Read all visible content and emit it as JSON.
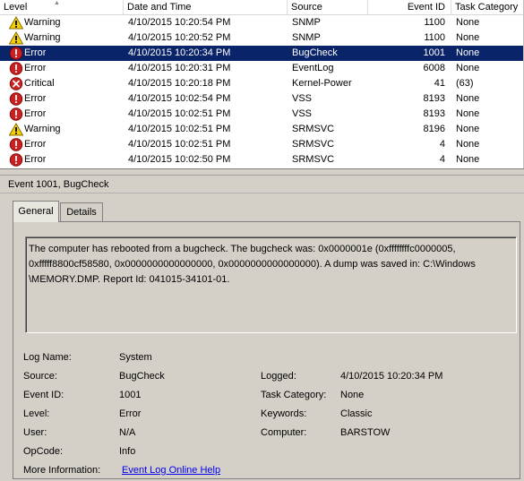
{
  "columns": [
    {
      "key": "level",
      "label": "Level"
    },
    {
      "key": "datetime",
      "label": "Date and Time"
    },
    {
      "key": "source",
      "label": "Source"
    },
    {
      "key": "event_id",
      "label": "Event ID"
    },
    {
      "key": "task_category",
      "label": "Task Category"
    }
  ],
  "rows": [
    {
      "icon": "warning",
      "level": "Warning",
      "datetime": "4/10/2015 10:20:54 PM",
      "source": "SNMP",
      "event_id": "1100",
      "task_category": "None",
      "selected": false
    },
    {
      "icon": "warning",
      "level": "Warning",
      "datetime": "4/10/2015 10:20:52 PM",
      "source": "SNMP",
      "event_id": "1100",
      "task_category": "None",
      "selected": false
    },
    {
      "icon": "error",
      "level": "Error",
      "datetime": "4/10/2015 10:20:34 PM",
      "source": "BugCheck",
      "event_id": "1001",
      "task_category": "None",
      "selected": true
    },
    {
      "icon": "error",
      "level": "Error",
      "datetime": "4/10/2015 10:20:31 PM",
      "source": "EventLog",
      "event_id": "6008",
      "task_category": "None",
      "selected": false
    },
    {
      "icon": "critical",
      "level": "Critical",
      "datetime": "4/10/2015 10:20:18 PM",
      "source": "Kernel-Power",
      "event_id": "41",
      "task_category": "(63)",
      "selected": false
    },
    {
      "icon": "error",
      "level": "Error",
      "datetime": "4/10/2015 10:02:54 PM",
      "source": "VSS",
      "event_id": "8193",
      "task_category": "None",
      "selected": false
    },
    {
      "icon": "error",
      "level": "Error",
      "datetime": "4/10/2015 10:02:51 PM",
      "source": "VSS",
      "event_id": "8193",
      "task_category": "None",
      "selected": false
    },
    {
      "icon": "warning",
      "level": "Warning",
      "datetime": "4/10/2015 10:02:51 PM",
      "source": "SRMSVC",
      "event_id": "8196",
      "task_category": "None",
      "selected": false
    },
    {
      "icon": "error",
      "level": "Error",
      "datetime": "4/10/2015 10:02:51 PM",
      "source": "SRMSVC",
      "event_id": "4",
      "task_category": "None",
      "selected": false
    },
    {
      "icon": "error",
      "level": "Error",
      "datetime": "4/10/2015 10:02:50 PM",
      "source": "SRMSVC",
      "event_id": "4",
      "task_category": "None",
      "selected": false
    }
  ],
  "detail": {
    "title": "Event 1001, BugCheck",
    "tabs": {
      "general": "General",
      "details": "Details"
    },
    "description_lines": [
      "The computer has rebooted from a bugcheck.  The bugcheck was: 0x0000001e (0xffffffffc0000005,",
      "0xfffff8800cf58580, 0x0000000000000000, 0x0000000000000000). A dump was saved in: C:\\Windows",
      "\\MEMORY.DMP. Report Id: 041015-34101-01."
    ],
    "fields": {
      "log_name_label": "Log Name:",
      "log_name": "System",
      "source_label": "Source:",
      "source": "BugCheck",
      "logged_label": "Logged:",
      "logged": "4/10/2015 10:20:34 PM",
      "event_id_label": "Event ID:",
      "event_id": "1001",
      "task_category_label": "Task Category:",
      "task_category": "None",
      "level_label": "Level:",
      "level": "Error",
      "keywords_label": "Keywords:",
      "keywords": "Classic",
      "user_label": "User:",
      "user": "N/A",
      "computer_label": "Computer:",
      "computer": "BARSTOW",
      "opcode_label": "OpCode:",
      "opcode": "Info",
      "more_info_label": "More Information:",
      "more_info_link": "Event Log Online Help"
    }
  },
  "colors": {
    "selection": "#0a246a",
    "link": "#0000ee",
    "warning": "#f5d000",
    "error": "#cc1f1f"
  }
}
